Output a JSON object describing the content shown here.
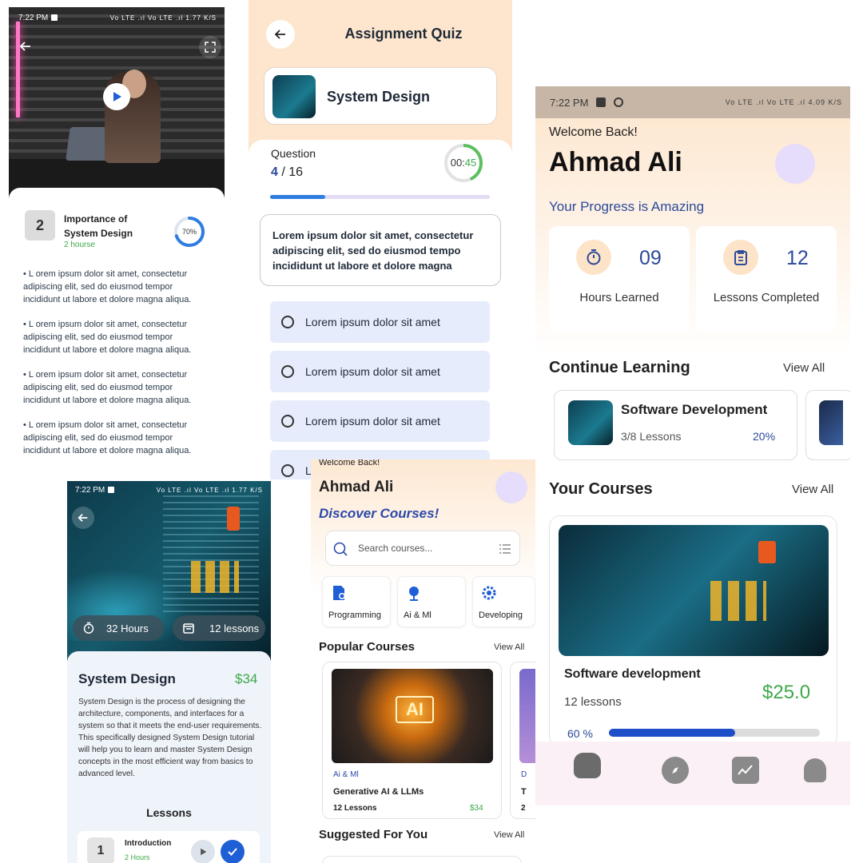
{
  "screen1": {
    "status_time": "7:22 PM",
    "status_right": "Vo LTE .ıl Vo LTE .ıl 1.77 K/S",
    "lesson_number": "2",
    "lesson_title": "Importance of System Design",
    "lesson_duration": "2 hourse",
    "progress_label": "70%",
    "progress_value": 70,
    "bullets": [
      "L orem ipsum dolor sit amet, consectetur adipiscing elit, sed do eiusmod tempor incididunt ut labore et dolore magna aliqua.",
      "L orem ipsum dolor sit amet, consectetur adipiscing elit, sed do eiusmod tempor incididunt ut labore et dolore magna aliqua.",
      "L orem ipsum dolor sit amet, consectetur adipiscing elit, sed do eiusmod tempor incididunt ut labore et dolore magna aliqua.",
      "L orem ipsum dolor sit amet, consectetur adipiscing elit, sed do eiusmod tempor incididunt ut labore et dolore magna aliqua."
    ]
  },
  "screen2": {
    "title": "Assignment Quiz",
    "course_name": "System Design",
    "question_label": "Question",
    "question_current": "4",
    "question_total": "/ 16",
    "question_progress": 0.25,
    "timer_minutes": "00:",
    "timer_seconds": "45",
    "question_text": "Lorem ipsum dolor sit amet, consectetur adipiscing elit, sed do eiusmod tempo incididunt ut labore et dolore magna",
    "options": [
      "Lorem ipsum dolor sit amet",
      "Lorem ipsum dolor sit amet",
      "Lorem ipsum dolor sit amet",
      "L"
    ]
  },
  "screen3": {
    "status_time": "7:22 PM",
    "status_right": "Vo LTE .ıl Vo LTE .ıl 4.09 K/S",
    "welcome": "Welcome Back!",
    "user_name": "Ahmad Ali",
    "progress_message": "Your Progress is Amazing",
    "stats": [
      {
        "value": "09",
        "label": "Hours Learned",
        "icon": "timer-icon"
      },
      {
        "value": "12",
        "label": "Lessons Completed",
        "icon": "clipboard-icon"
      }
    ],
    "continue_title": "Continue Learning",
    "continue_view_all": "View All",
    "continue_course": {
      "title": "Software Development",
      "lessons": "3/8 Lessons",
      "percent": "20%"
    },
    "courses_title": "Your Courses",
    "courses_view_all": "View All",
    "course": {
      "title": "Software development",
      "lessons": "12 lessons",
      "price": "$25.0",
      "progress_label": "60 %",
      "progress_value": 0.6
    },
    "nav_icons": [
      "home-icon",
      "compass-icon",
      "chart-icon",
      "bell-icon"
    ]
  },
  "screen4": {
    "status_time": "7:22 PM",
    "status_right": "Vo LTE .ıl Vo LTE .ıl 1.77 K/S",
    "hours": "32 Hours",
    "lessons": "12 lessons",
    "title": "System Design",
    "price": "$34",
    "description": "System Design is the process of designing the architecture, components, and interfaces for a system so that it meets the end-user requirements. This specifically designed System Design tutorial will help you to learn and master System Design concepts in the most efficient way from basics to advanced level.",
    "lessons_heading": "Lessons",
    "lesson_item": {
      "number": "1",
      "title": "Introduction",
      "duration": "2 Hours"
    }
  },
  "screen5": {
    "welcome": "Welcome Back!",
    "user_name": "Ahmad Ali",
    "discover": "Discover Courses!",
    "search_placeholder": "Search courses...",
    "categories": [
      {
        "label": "Programming",
        "icon": "code-file-icon"
      },
      {
        "label": "Ai & Ml",
        "icon": "tree-icon"
      },
      {
        "label": "Developing",
        "icon": "gear-bug-icon"
      }
    ],
    "popular_title": "Popular Courses",
    "popular_view_all": "View All",
    "popular_course": {
      "badge": "AI",
      "category": "Ai & Ml",
      "title": "Generative AI & LLMs",
      "lessons": "12 Lessons",
      "price": "$34"
    },
    "popular_next_partial": {
      "category": "D",
      "title": "T",
      "lessons": "2"
    },
    "suggested_title": "Suggested For You",
    "suggested_view_all": "View All"
  },
  "colors": {
    "accent_blue": "#2b4a9a",
    "progress_blue": "#1f5fd6",
    "green": "#3ea84a",
    "peach": "#fde6cd",
    "lavender": "#e4d9fb"
  }
}
